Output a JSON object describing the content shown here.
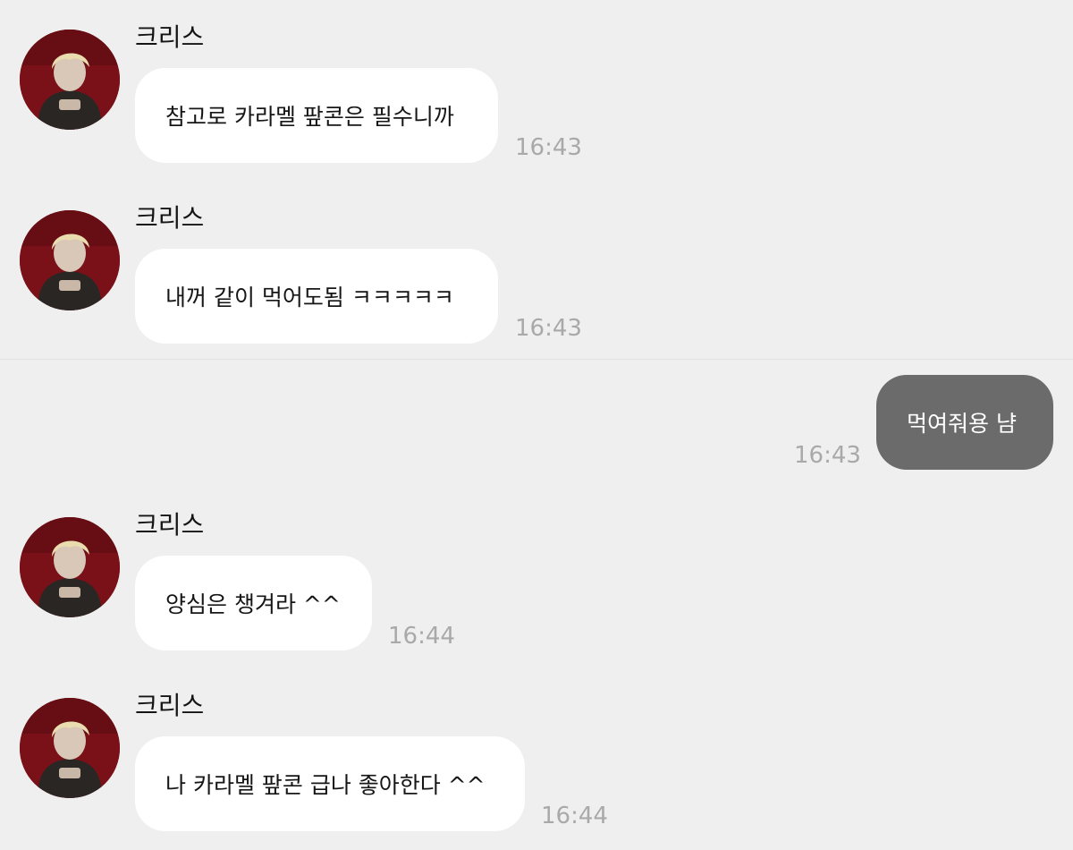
{
  "messages": [
    {
      "sender": "크리스",
      "text": "참고로 카라멜 팦콘은 필수니까",
      "time": "16:43"
    },
    {
      "sender": "크리스",
      "text": "내꺼 같이 먹어도됨 ㅋㅋㅋㅋㅋ",
      "time": "16:43"
    },
    {
      "sender": "me",
      "text": "먹여줘용 냠",
      "time": "16:43"
    },
    {
      "sender": "크리스",
      "text": "양심은 챙겨라 ^^",
      "time": "16:44"
    },
    {
      "sender": "크리스",
      "text": "나 카라멜 팦콘 급나 좋아한다 ^^",
      "time": "16:44"
    }
  ],
  "icons": {
    "avatar": "profile-photo-icon"
  },
  "colors": {
    "background": "#efefef",
    "incoming_bubble": "#ffffff",
    "outgoing_bubble": "#6b6b6b",
    "timestamp": "#a9a9a9",
    "avatar_background": "#6e0f16"
  }
}
